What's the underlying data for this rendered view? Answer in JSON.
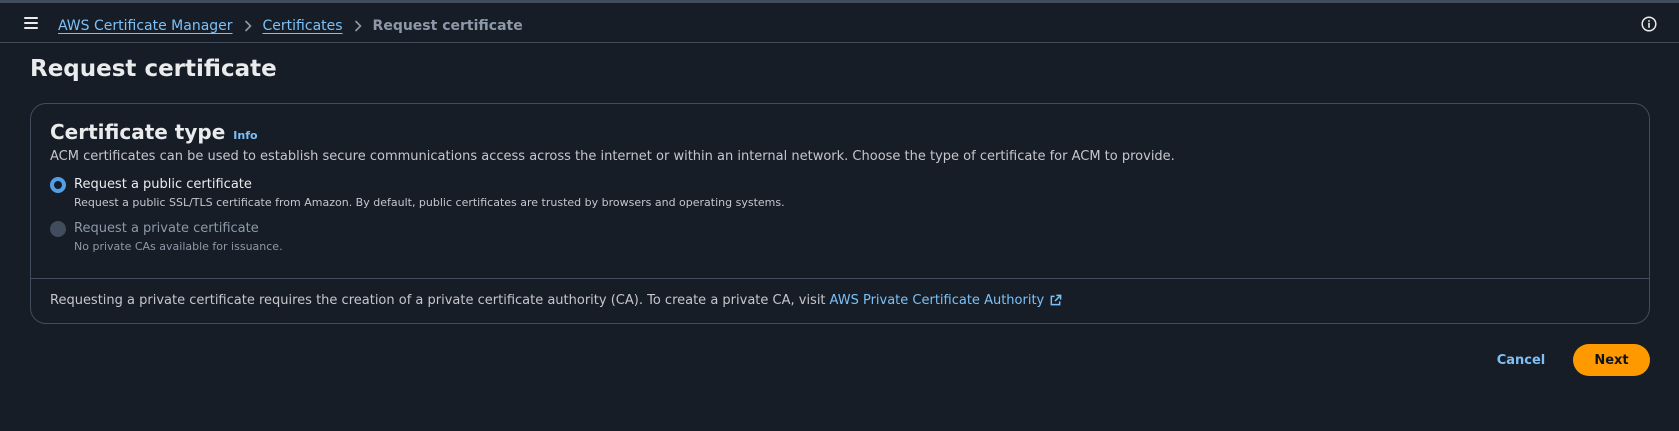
{
  "breadcrumb": {
    "items": [
      "AWS Certificate Manager",
      "Certificates"
    ],
    "current": "Request certificate"
  },
  "page": {
    "title": "Request certificate"
  },
  "panel": {
    "title": "Certificate type",
    "info_label": "Info",
    "description": "ACM certificates can be used to establish secure communications access across the internet or within an internal network. Choose the type of certificate for ACM to provide.",
    "options": [
      {
        "label": "Request a public certificate",
        "description": "Request a public SSL/TLS certificate from Amazon. By default, public certificates are trusted by browsers and operating systems.",
        "selected": true,
        "disabled": false
      },
      {
        "label": "Request a private certificate",
        "description": "No private CAs available for issuance.",
        "selected": false,
        "disabled": true
      }
    ],
    "footer_text": "Requesting a private certificate requires the creation of a private certificate authority (CA). To create a private CA, visit",
    "footer_link": "AWS Private Certificate Authority"
  },
  "actions": {
    "cancel_label": "Cancel",
    "next_label": "Next"
  },
  "icons": {
    "menu": "hamburger-menu-icon",
    "separator": "chevron-right-icon",
    "info": "info-circle-icon",
    "external": "external-link-icon"
  },
  "colors": {
    "background": "#161d26",
    "link": "#7cc0f7",
    "primary_button": "#ff9900",
    "radio_selected": "#539fe5",
    "border": "#414d5c"
  }
}
